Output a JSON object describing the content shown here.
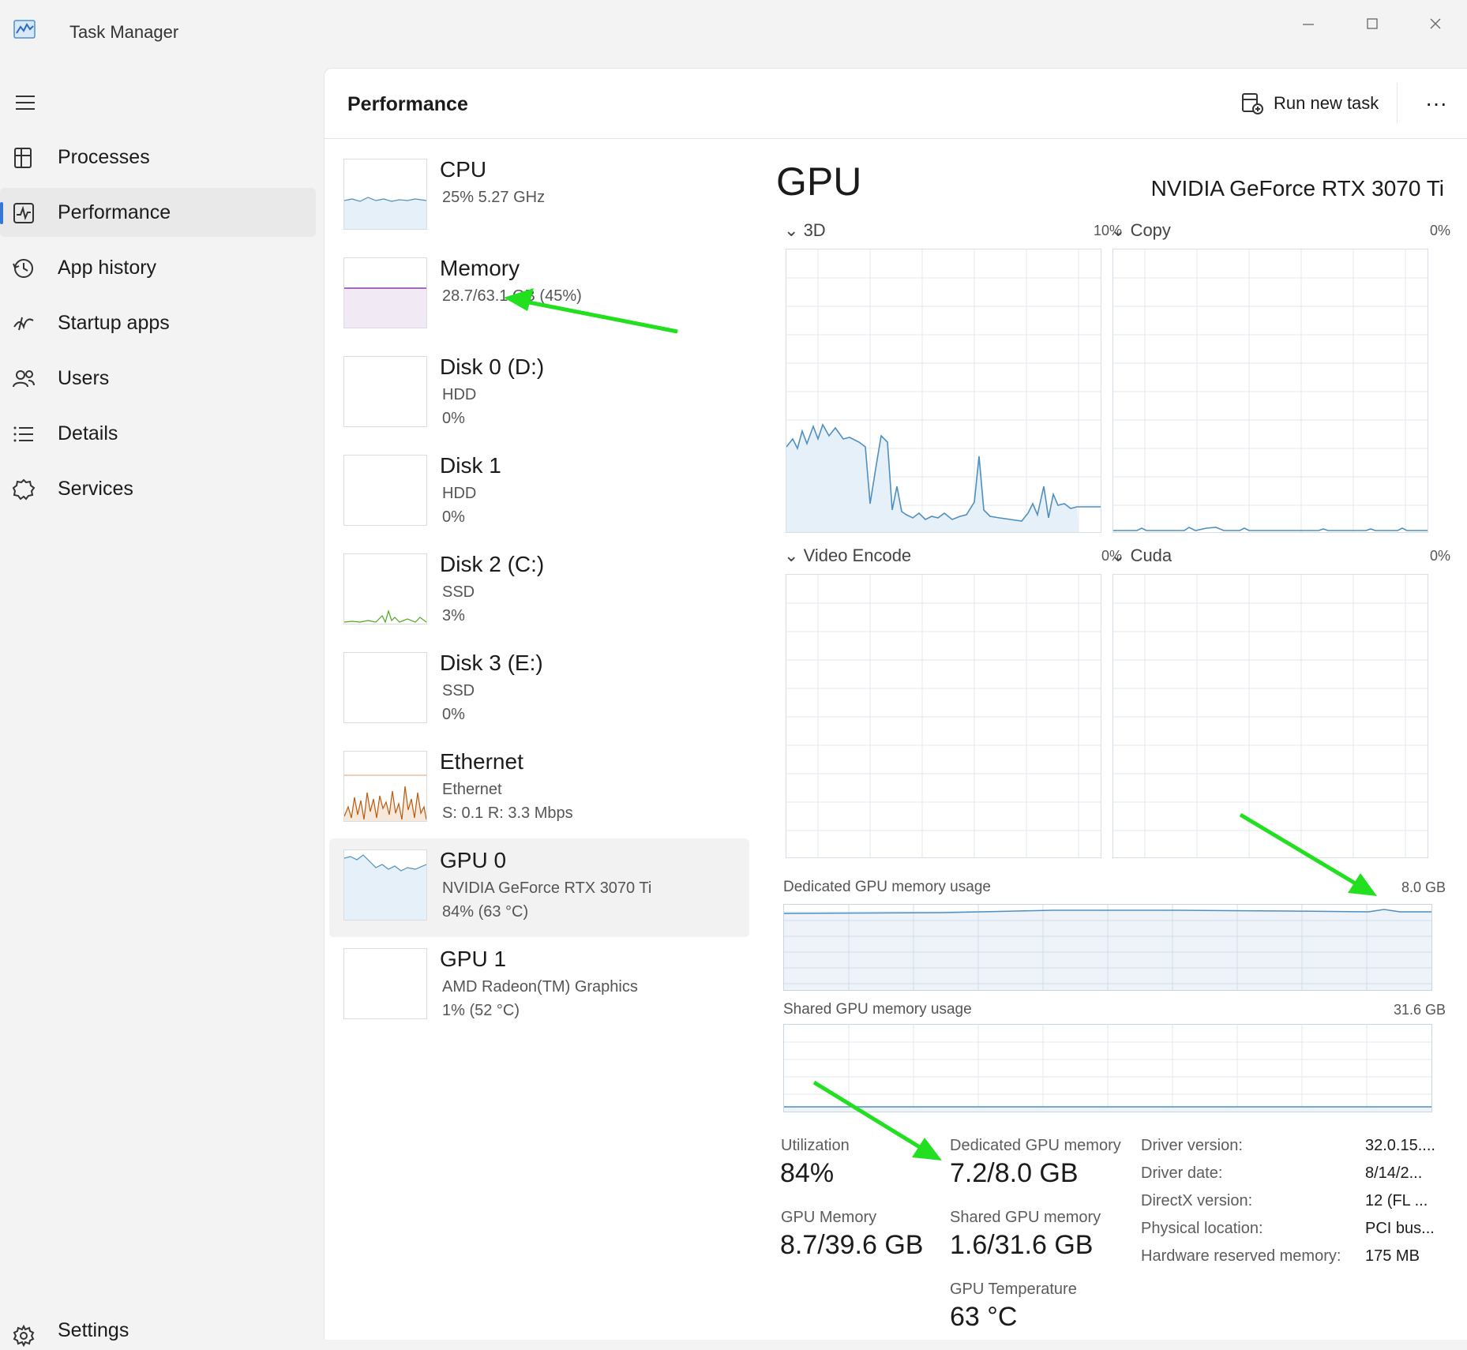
{
  "window": {
    "title": "Task Manager",
    "controls": [
      "minimize",
      "maximize",
      "close"
    ]
  },
  "sidebar": {
    "items": [
      {
        "label": "Processes",
        "icon": "processes-icon"
      },
      {
        "label": "Performance",
        "icon": "performance-icon",
        "active": true
      },
      {
        "label": "App history",
        "icon": "app-history-icon"
      },
      {
        "label": "Startup apps",
        "icon": "startup-apps-icon"
      },
      {
        "label": "Users",
        "icon": "users-icon"
      },
      {
        "label": "Details",
        "icon": "details-icon"
      },
      {
        "label": "Services",
        "icon": "services-icon"
      }
    ],
    "settings_label": "Settings"
  },
  "header": {
    "title": "Performance",
    "run_task_label": "Run new task",
    "more_label": "···"
  },
  "resources": [
    {
      "name": "CPU",
      "line1": "25%  5.27 GHz",
      "line2": ""
    },
    {
      "name": "Memory",
      "line1": "28.7/63.1 GB (45%)",
      "line2": ""
    },
    {
      "name": "Disk 0 (D:)",
      "line1": "HDD",
      "line2": "0%"
    },
    {
      "name": "Disk 1",
      "line1": "HDD",
      "line2": "0%"
    },
    {
      "name": "Disk 2 (C:)",
      "line1": "SSD",
      "line2": "3%"
    },
    {
      "name": "Disk 3 (E:)",
      "line1": "SSD",
      "line2": "0%"
    },
    {
      "name": "Ethernet",
      "line1": "Ethernet",
      "line2": "S: 0.1  R: 3.3 Mbps"
    },
    {
      "name": "GPU 0",
      "line1": "NVIDIA GeForce RTX 3070 Ti",
      "line2": "84%  (63 °C)",
      "active": true
    },
    {
      "name": "GPU 1",
      "line1": "AMD Radeon(TM) Graphics",
      "line2": "1%  (52 °C)"
    }
  ],
  "gpu": {
    "title": "GPU",
    "model": "NVIDIA GeForce RTX 3070 Ti",
    "engines": [
      {
        "label": "3D",
        "percent": "10%"
      },
      {
        "label": "Copy",
        "percent": "0%"
      },
      {
        "label": "Video Encode",
        "percent": "0%"
      },
      {
        "label": "Cuda",
        "percent": "0%"
      }
    ],
    "dedicated_memory_chart": {
      "label": "Dedicated GPU memory usage",
      "max": "8.0 GB"
    },
    "shared_memory_chart": {
      "label": "Shared GPU memory usage",
      "max": "31.6 GB"
    },
    "stats": {
      "utilization": {
        "label": "Utilization",
        "value": "84%"
      },
      "dedicated": {
        "label": "Dedicated GPU memory",
        "value": "7.2/8.0 GB"
      },
      "gpu_memory": {
        "label": "GPU Memory",
        "value": "8.7/39.6 GB"
      },
      "shared": {
        "label": "Shared GPU memory",
        "value": "1.6/31.6 GB"
      },
      "temperature": {
        "label": "GPU Temperature",
        "value": "63 °C"
      }
    },
    "info": [
      {
        "label": "Driver version:",
        "value": "32.0.15...."
      },
      {
        "label": "Driver date:",
        "value": "8/14/2..."
      },
      {
        "label": "DirectX version:",
        "value": "12 (FL ..."
      },
      {
        "label": "Physical location:",
        "value": "PCI bus..."
      },
      {
        "label": "Hardware reserved memory:",
        "value": "175 MB"
      }
    ]
  },
  "colors": {
    "accent": "#3577d6",
    "gpu_line": "#4f8fc0",
    "memory_line": "#8a3fa0",
    "disk_line": "#4da71f",
    "ethernet_line": "#b85a0f",
    "annotation_arrow": "#22e01f"
  }
}
